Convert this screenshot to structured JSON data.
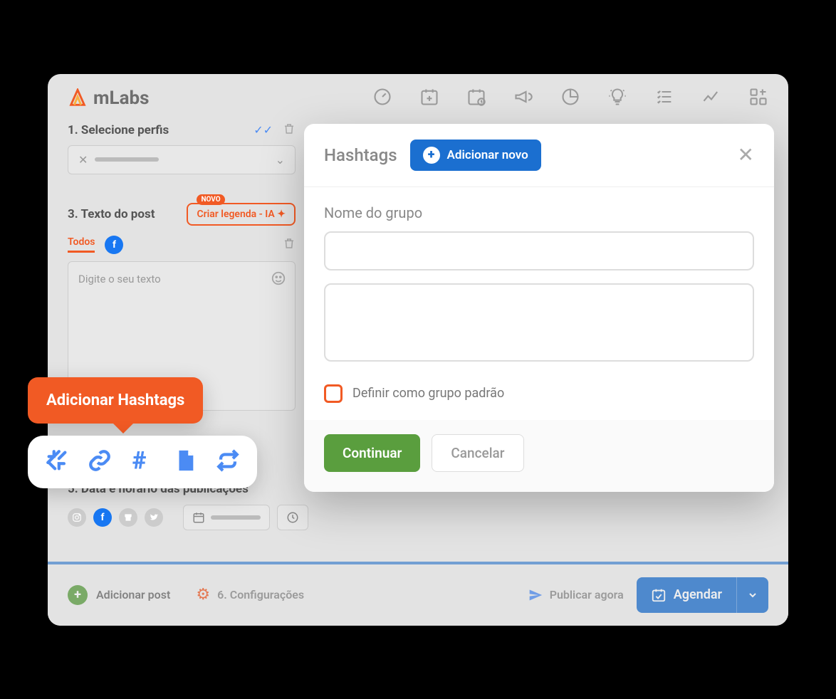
{
  "brand": "mLabs",
  "section1_title": "1. Selecione perfis",
  "section3_title": "3. Texto do post",
  "novo_badge": "NOVO",
  "criar_legenda": "Criar legenda - IA",
  "tab_todos": "Todos",
  "textarea_placeholder": "Digite o seu texto",
  "tooltip_text": "Adicionar Hashtags",
  "section5_title": "5. Data e horário das publicações",
  "footer": {
    "add_post": "Adicionar post",
    "config": "6. Configurações",
    "publish_now": "Publicar agora",
    "agendar": "Agendar"
  },
  "modal": {
    "title": "Hashtags",
    "add_new": "Adicionar novo",
    "field_label": "Nome do grupo",
    "checkbox_label": "Definir como grupo padrão",
    "continue": "Continuar",
    "cancel": "Cancelar"
  }
}
